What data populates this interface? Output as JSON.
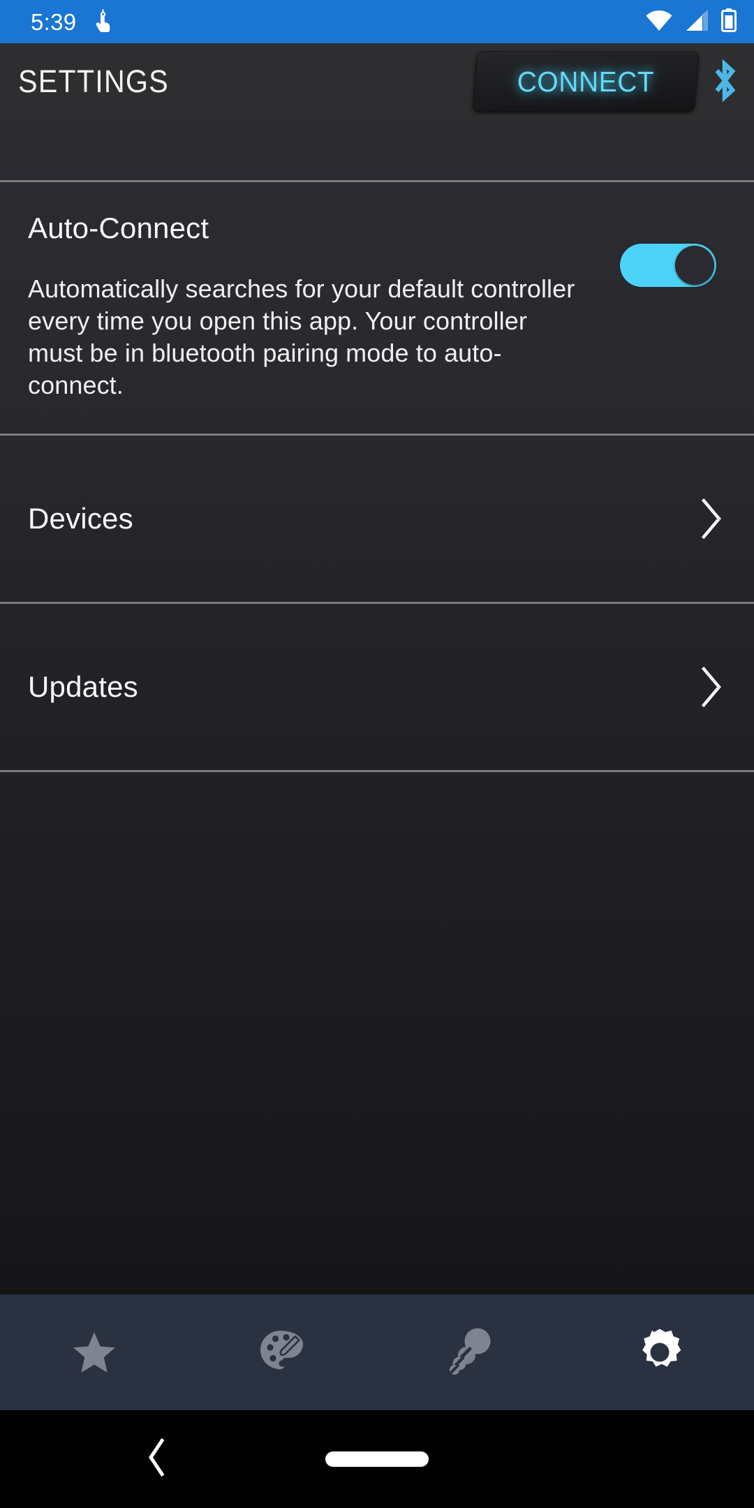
{
  "status_bar": {
    "time": "5:39",
    "icons": [
      "touch-pointer-icon",
      "wifi-icon",
      "cellular-signal-icon",
      "battery-icon"
    ],
    "background_color": "#1A76D2"
  },
  "app_bar": {
    "title": "SETTINGS",
    "connect_button_label": "CONNECT",
    "connect_accent_color": "#63D9F7",
    "bluetooth_icon": "bluetooth-icon",
    "bluetooth_color": "#4DB7E8",
    "background_color": "#2E2E30"
  },
  "settings": {
    "auto_connect": {
      "title": "Auto-Connect",
      "description": "Automatically searches for your default controller every time you open this app. Your controller must be in bluetooth pairing mode to auto-connect.",
      "toggle_state": "on",
      "toggle_on_color": "#4DD2F7",
      "toggle_knob_color": "#2A2A30"
    },
    "rows": [
      {
        "label": "Devices",
        "chevron": "chevron-right-icon"
      },
      {
        "label": "Updates",
        "chevron": "chevron-right-icon"
      }
    ]
  },
  "tab_bar": {
    "background_color": "#2A3241",
    "inactive_color": "#7F8490",
    "active_color": "#FFFFFF",
    "tabs": [
      {
        "icon": "star-icon",
        "active": false
      },
      {
        "icon": "paint-palette-icon",
        "active": false
      },
      {
        "icon": "rumble-vibration-icon",
        "active": false
      },
      {
        "icon": "gear-icon",
        "active": true
      }
    ]
  },
  "system_nav": {
    "back_icon": "back-chevron-icon",
    "home_indicator": "home-pill-indicator",
    "background_color": "#000000"
  }
}
